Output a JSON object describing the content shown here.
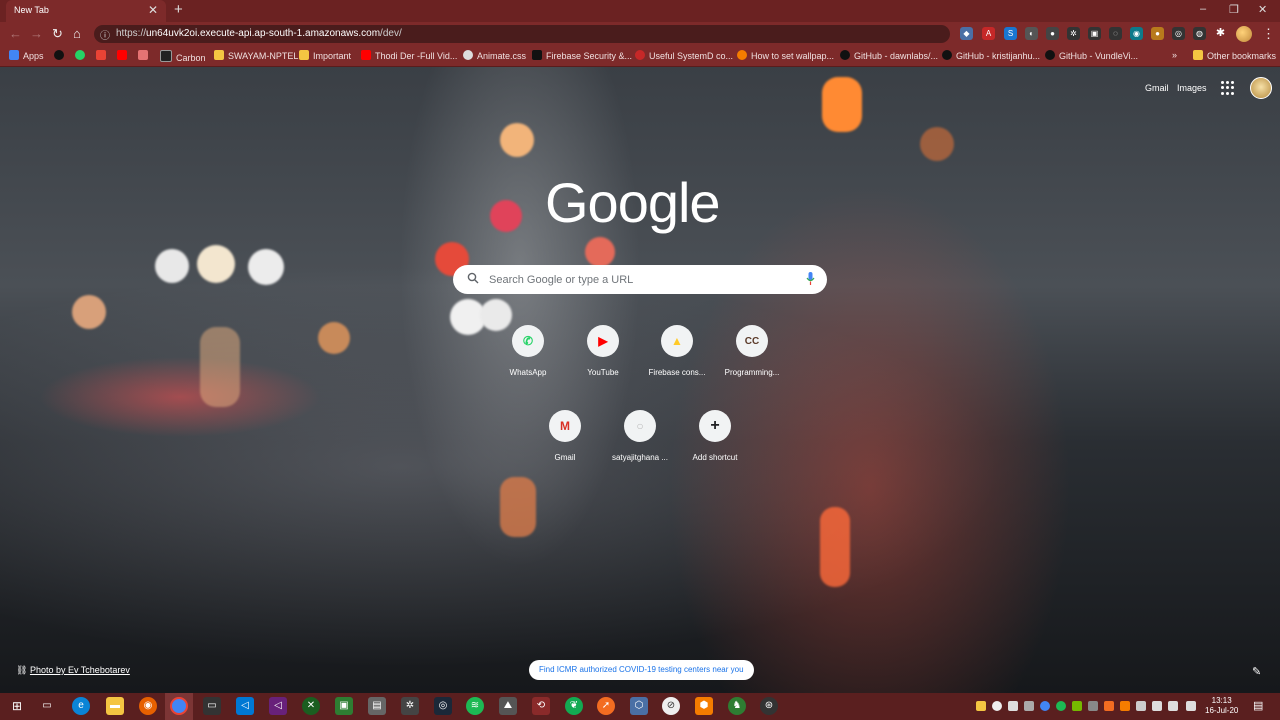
{
  "tab": {
    "title": "New Tab",
    "close": "✕",
    "new": "+"
  },
  "window": {
    "minimize": "–",
    "restore": "❐",
    "close": "✕"
  },
  "toolbar": {
    "back": "←",
    "forward": "→",
    "reload": "↻",
    "home": "⌂",
    "url_prefix": "https://",
    "url_host": "un64uvk2oi.execute-api.ap-south-1.amazonaws.com",
    "url_path": "/dev/",
    "menu": "⋮"
  },
  "bookmarks": {
    "apps": "Apps",
    "items": [
      "Carbon",
      "SWAYAM-NPTEL",
      "Important",
      "Thodi Der -Full Vid...",
      "Animate.css",
      "Firebase Security &...",
      "Useful SystemD co...",
      "How to set wallpap...",
      "GitHub - dawnlabs/...",
      "GitHub - kristijanhu...",
      "GitHub - VundleVi..."
    ],
    "more": "»",
    "other": "Other bookmarks"
  },
  "google": {
    "gmail": "Gmail",
    "images": "Images",
    "logo": "Google",
    "search_placeholder": "Search Google or type a URL",
    "shortcuts": [
      {
        "label": "WhatsApp",
        "glyph": "✆",
        "color": "#25d366"
      },
      {
        "label": "YouTube",
        "glyph": "▶",
        "color": "#ff0000"
      },
      {
        "label": "Firebase cons...",
        "glyph": "▲",
        "color": "#ffca28"
      },
      {
        "label": "Programming...",
        "glyph": "CC",
        "color": "#5b3a29"
      },
      {
        "label": "Gmail",
        "glyph": "M",
        "color": "#d93025"
      },
      {
        "label": "satyajitghana ...",
        "glyph": "○",
        "color": "#bbbbbb"
      },
      {
        "label": "Add shortcut",
        "glyph": "+",
        "color": "#202124"
      }
    ],
    "photo_credit": "Photo by Ev Tchebotarev",
    "covid_banner": "Find ICMR authorized COVID-19 testing centers near you"
  },
  "taskbar": {
    "time": "13:13",
    "date": "16-Jul-20"
  }
}
